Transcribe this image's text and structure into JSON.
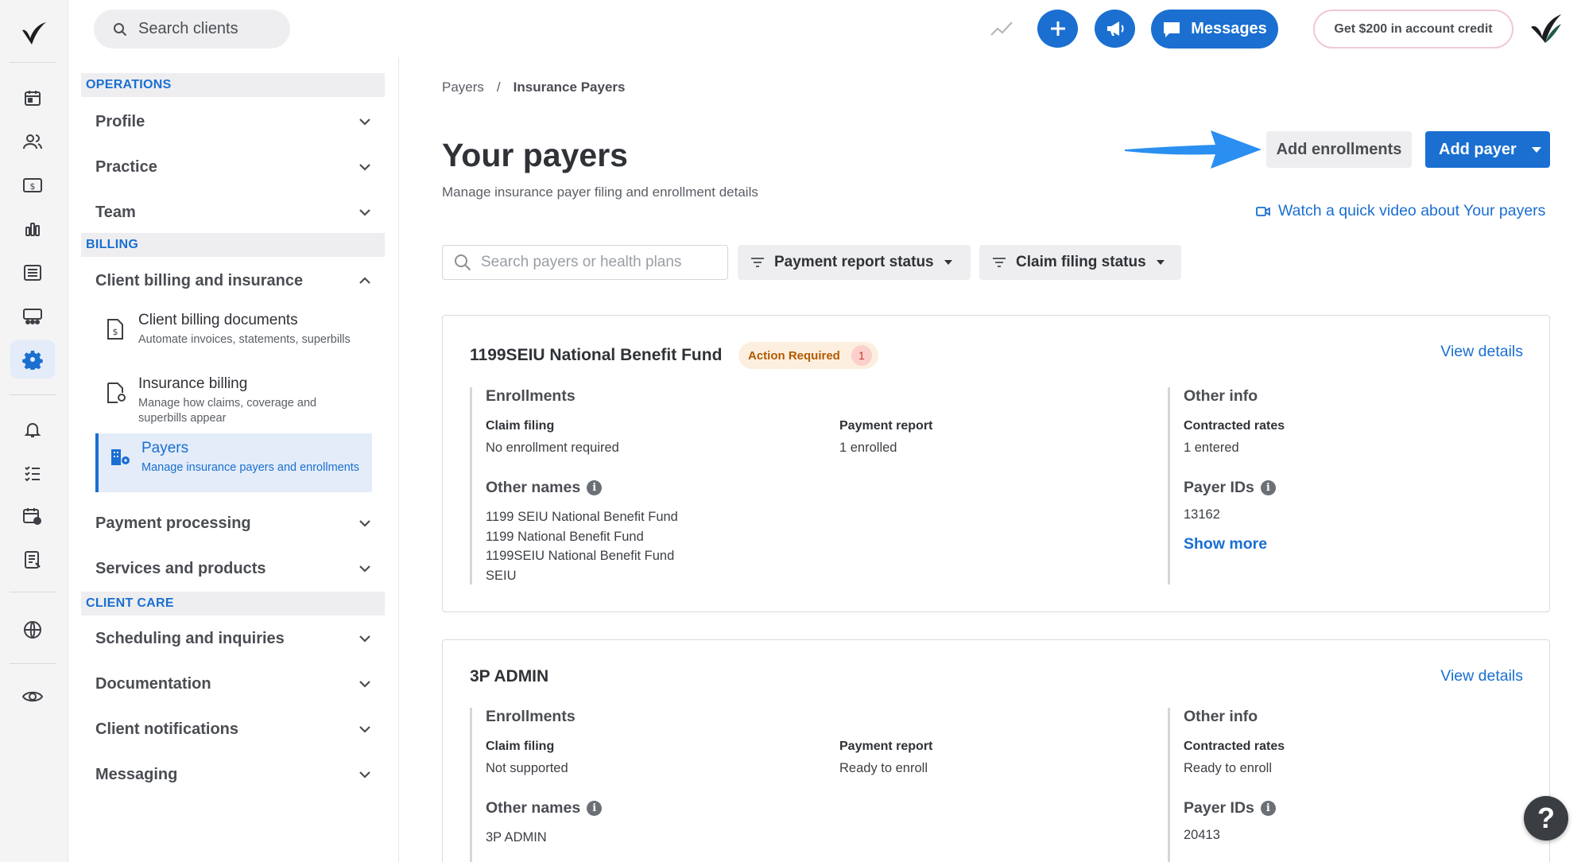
{
  "topbar": {
    "search_placeholder": "Search clients",
    "messages_label": "Messages",
    "credit_label": "Get $200 in account credit"
  },
  "menu": {
    "operations_head": "OPERATIONS",
    "profile": "Profile",
    "practice": "Practice",
    "team": "Team",
    "billing_head": "BILLING",
    "client_billing": "Client billing and insurance",
    "sub_items": [
      {
        "title": "Client billing documents",
        "desc": "Automate invoices, statements, superbills"
      },
      {
        "title": "Insurance billing",
        "desc": "Manage how claims, coverage and superbills appear"
      },
      {
        "title": "Payers",
        "desc": "Manage insurance payers and enrollments"
      }
    ],
    "payment_processing": "Payment processing",
    "services_products": "Services and products",
    "client_care_head": "CLIENT CARE",
    "scheduling": "Scheduling and inquiries",
    "documentation": "Documentation",
    "client_notifications": "Client notifications",
    "messaging": "Messaging"
  },
  "main": {
    "breadcrumb_root": "Payers",
    "breadcrumb_sep": "/",
    "breadcrumb_current": "Insurance Payers",
    "title": "Your payers",
    "subtitle": "Manage insurance payer filing and enrollment details",
    "add_enrollments": "Add enrollments",
    "add_payer": "Add payer",
    "video_link": "Watch a quick video about Your payers",
    "search_placeholder": "Search payers or health plans",
    "filter_payment": "Payment report status",
    "filter_claim": "Claim filing status"
  },
  "labels": {
    "enrollments": "Enrollments",
    "claim_filing": "Claim filing",
    "payment_report": "Payment report",
    "other_info": "Other info",
    "contracted_rates": "Contracted rates",
    "other_names": "Other names",
    "payer_ids": "Payer IDs",
    "view_details": "View details",
    "show_more": "Show more"
  },
  "payers": [
    {
      "name": "1199SEIU National Benefit Fund",
      "badge": "Action Required",
      "badge_count": "1",
      "claim_filing": "No enrollment required",
      "payment_report": "1 enrolled",
      "contracted_rates": "1 entered",
      "other_names": [
        "1199 SEIU National Benefit Fund",
        "1199 National Benefit Fund",
        "1199SEIU National Benefit Fund",
        "SEIU"
      ],
      "payer_ids": [
        "13162"
      ]
    },
    {
      "name": "3P ADMIN",
      "claim_filing": "Not supported",
      "payment_report": "Ready to enroll",
      "contracted_rates": "Ready to enroll",
      "other_names": [
        "3P ADMIN"
      ],
      "payer_ids": [
        "20413"
      ]
    }
  ],
  "help_label": "?"
}
